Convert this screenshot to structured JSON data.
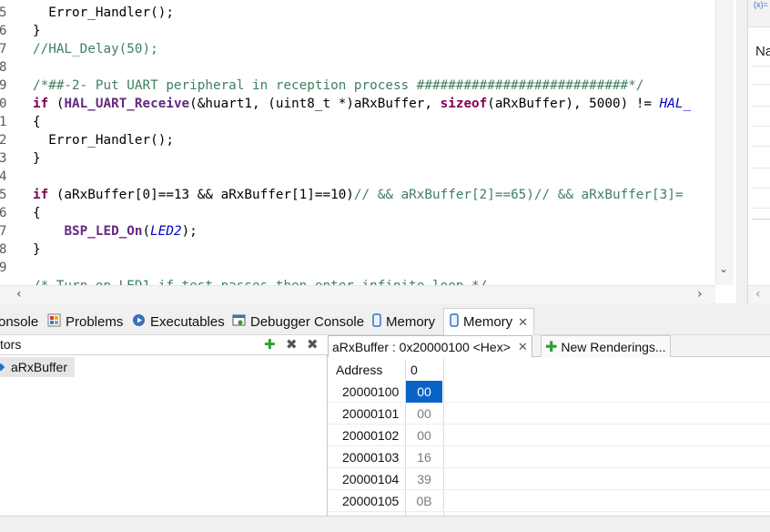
{
  "editor": {
    "line_numbers": [
      "5",
      "6",
      "7",
      "8",
      "9",
      "0",
      "1",
      "2",
      "3",
      "4",
      "5",
      "6",
      "7",
      "8",
      "9"
    ],
    "lines": [
      {
        "parts": [
          {
            "t": "  Error_Handler();",
            "c": ""
          }
        ]
      },
      {
        "parts": [
          {
            "t": "}",
            "c": ""
          }
        ]
      },
      {
        "parts": [
          {
            "t": "//HAL_Delay(50);",
            "c": "cm"
          }
        ]
      },
      {
        "parts": [
          {
            "t": "",
            "c": ""
          }
        ]
      },
      {
        "parts": [
          {
            "t": "/*##-2- Put UART peripheral in reception process ###########################*/",
            "c": "cm"
          }
        ]
      },
      {
        "parts": [
          {
            "t": "if",
            "c": "kw"
          },
          {
            "t": " (",
            "c": ""
          },
          {
            "t": "HAL_UART_Receive",
            "c": "fnp"
          },
          {
            "t": "(&huart1, (uint8_t *)aRxBuffer, ",
            "c": ""
          },
          {
            "t": "sizeof",
            "c": "kw"
          },
          {
            "t": "(aRxBuffer), 5000) != ",
            "c": ""
          },
          {
            "t": "HAL_",
            "c": "it"
          }
        ]
      },
      {
        "parts": [
          {
            "t": "{",
            "c": ""
          }
        ]
      },
      {
        "parts": [
          {
            "t": "  Error_Handler();",
            "c": ""
          }
        ]
      },
      {
        "parts": [
          {
            "t": "}",
            "c": ""
          }
        ]
      },
      {
        "parts": [
          {
            "t": "",
            "c": ""
          }
        ]
      },
      {
        "parts": [
          {
            "t": "if",
            "c": "kw"
          },
          {
            "t": " (aRxBuffer[0]==13 && aRxBuffer[1]==10)",
            "c": ""
          },
          {
            "t": "// && aRxBuffer[2]==65)// && aRxBuffer[3]=",
            "c": "cm"
          }
        ]
      },
      {
        "parts": [
          {
            "t": "{",
            "c": ""
          }
        ]
      },
      {
        "parts": [
          {
            "t": "    ",
            "c": ""
          },
          {
            "t": "BSP_LED_On",
            "c": "fnp"
          },
          {
            "t": "(",
            "c": ""
          },
          {
            "t": "LED2",
            "c": "it"
          },
          {
            "t": ");",
            "c": ""
          }
        ]
      },
      {
        "parts": [
          {
            "t": "}",
            "c": ""
          }
        ]
      },
      {
        "parts": [
          {
            "t": "",
            "c": ""
          }
        ]
      },
      {
        "parts": [
          {
            "t": "/* Turn on LED1 if test passes then enter infinite loop */",
            "c": "cm"
          }
        ]
      }
    ]
  },
  "right_panel": {
    "icon_text": "(x)=",
    "label": "Na"
  },
  "view_tabs": {
    "console": "onsole",
    "problems": "Problems",
    "executables": "Executables",
    "debugger_console": "Debugger Console",
    "memory1": "Memory",
    "memory2": "Memory"
  },
  "monitors": {
    "title": "tors",
    "items": [
      "aRxBuffer"
    ]
  },
  "renderings": {
    "active_tab": "aRxBuffer : 0x20000100 <Hex>",
    "new_renderings": "New Renderings...",
    "columns": [
      "Address",
      "0"
    ],
    "rows": [
      {
        "address": "20000100",
        "value": "00"
      },
      {
        "address": "20000101",
        "value": "00"
      },
      {
        "address": "20000102",
        "value": "00"
      },
      {
        "address": "20000103",
        "value": "16"
      },
      {
        "address": "20000104",
        "value": "39"
      },
      {
        "address": "20000105",
        "value": "0B"
      }
    ]
  },
  "colors": {
    "keyword": "#7f0055",
    "comment": "#3f7f5f",
    "selection": "#0a64c8"
  }
}
